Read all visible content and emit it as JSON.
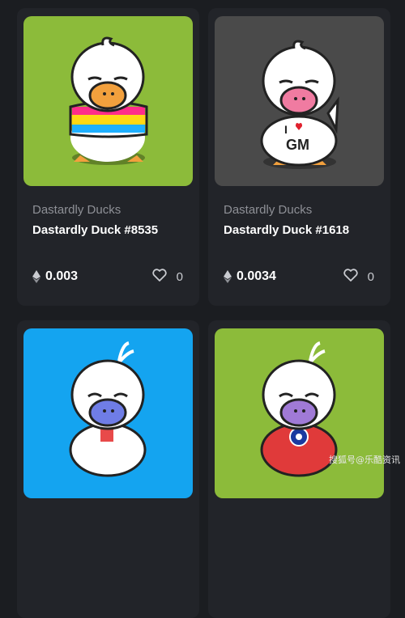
{
  "cards": [
    {
      "collection": "Dastardly Ducks",
      "name": "Dastardly Duck #8535",
      "price": "0.003",
      "likes": "0",
      "background_color": "#8cbb3a",
      "beak_color": "#f2a03d",
      "shirt": "pansexual-flag-stripes"
    },
    {
      "collection": "Dastardly Ducks",
      "name": "Dastardly Duck #1618",
      "price": "0.0034",
      "likes": "0",
      "background_color": "#4a4a4a",
      "beak_color": "#f07ba1",
      "shirt": "white",
      "shirt_text_top": "I",
      "shirt_text_bottom": "GM"
    },
    {
      "background_color": "#14a4f0",
      "beak_color": "#6f7de6",
      "shirt": "white-with-red-cat"
    },
    {
      "background_color": "#8cbb3a",
      "beak_color": "#a07ad6",
      "shirt": "red-with-emblem"
    }
  ],
  "icons": {
    "price": "ethereum-icon",
    "likes": "heart-icon"
  },
  "watermark": "搜狐号@乐酷资讯"
}
